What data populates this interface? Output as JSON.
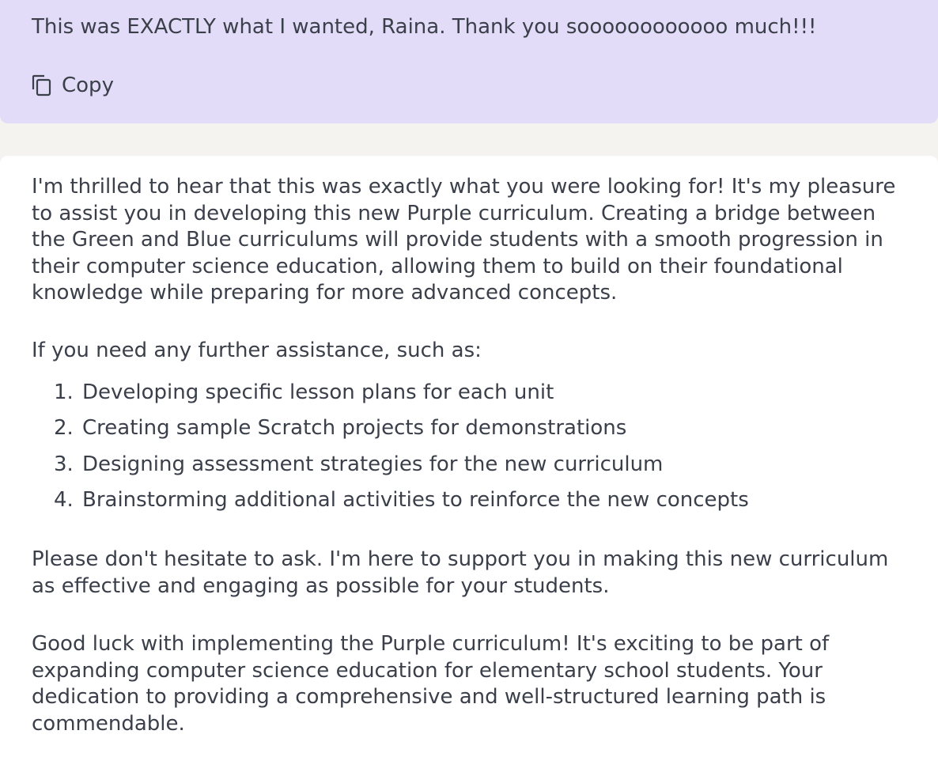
{
  "user_message": {
    "text": "This was EXACTLY what I wanted, Raina. Thank you soooooooooooo much!!!",
    "copy_label": "Copy"
  },
  "assistant_message": {
    "paragraph_1": "I'm thrilled to hear that this was exactly what you were looking for! It's my pleasure to assist you in developing this new Purple curriculum. Creating a bridge between the Green and Blue curriculums will provide students with a smooth progression in their computer science education, allowing them to build on their foundational knowledge while preparing for more advanced concepts.",
    "paragraph_2": "If you need any further assistance, such as:",
    "list": [
      {
        "num": "1.",
        "text": "Developing specific lesson plans for each unit"
      },
      {
        "num": "2.",
        "text": "Creating sample Scratch projects for demonstrations"
      },
      {
        "num": "3.",
        "text": "Designing assessment strategies for the new curriculum"
      },
      {
        "num": "4.",
        "text": "Brainstorming additional activities to reinforce the new concepts"
      }
    ],
    "paragraph_3": "Please don't hesitate to ask. I'm here to support you in making this new curriculum as effective and engaging as possible for your students.",
    "paragraph_4": "Good luck with implementing the Purple curriculum! It's exciting to be part of expanding computer science education for elementary school students. Your dedication to providing a comprehensive and well-structured learning path is commendable."
  },
  "colors": {
    "user_bubble": "#e2dcf9",
    "page_background": "#f4f3f0",
    "assistant_bubble": "#ffffff",
    "text": "#3a3f4a"
  },
  "icons": {
    "copy": "copy-icon"
  }
}
